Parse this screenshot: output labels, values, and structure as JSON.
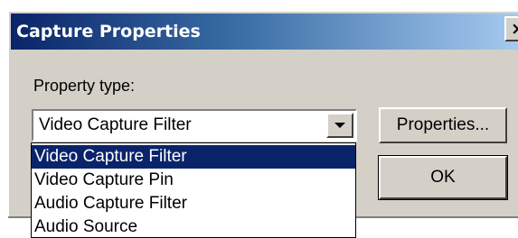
{
  "window": {
    "title": "Capture Properties",
    "close_glyph": "×"
  },
  "form": {
    "property_type_label": "Property type:",
    "combo_value": "Video Capture Filter",
    "properties_button": "Properties...",
    "ok_button": "OK"
  },
  "dropdown": {
    "items": [
      {
        "label": "Video Capture Filter",
        "selected": true
      },
      {
        "label": "Video Capture Pin",
        "selected": false
      },
      {
        "label": "Audio Capture Filter",
        "selected": false
      },
      {
        "label": "Audio Source",
        "selected": false
      }
    ]
  },
  "colors": {
    "titlebar_start": "#0a246a",
    "titlebar_end": "#a6caf0",
    "selection": "#0a246a",
    "face": "#d4d0c8"
  },
  "icons": {
    "close": "close-icon",
    "dropdown_arrow": "chevron-down-icon"
  }
}
